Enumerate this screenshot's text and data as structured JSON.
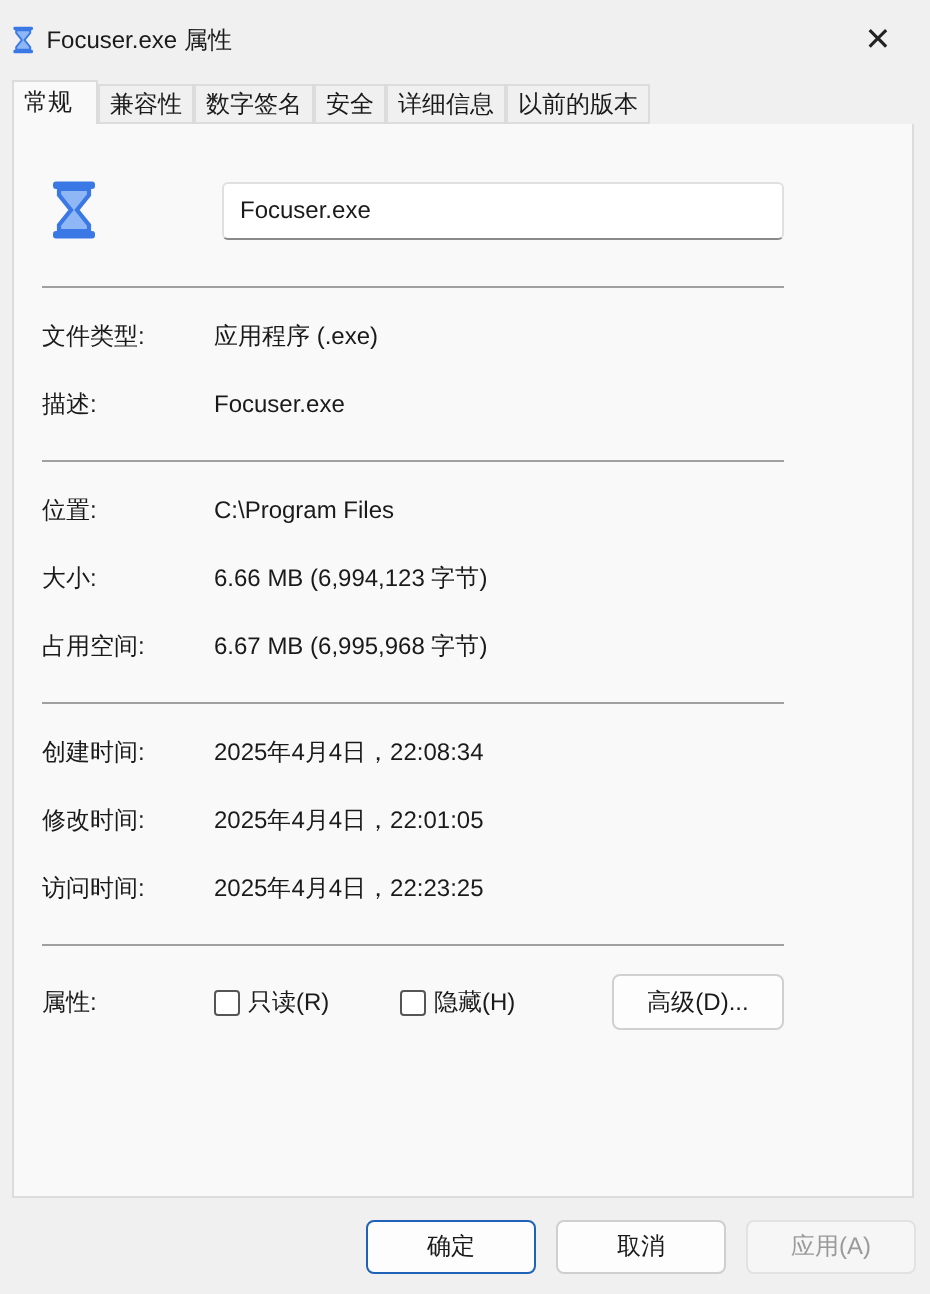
{
  "window": {
    "title": "Focuser.exe 属性",
    "close": "✕"
  },
  "tabs": [
    {
      "label": "常规",
      "selected": true
    },
    {
      "label": "兼容性",
      "selected": false
    },
    {
      "label": "数字签名",
      "selected": false
    },
    {
      "label": "安全",
      "selected": false
    },
    {
      "label": "详细信息",
      "selected": false
    },
    {
      "label": "以前的版本",
      "selected": false
    }
  ],
  "file_name": {
    "value": "Focuser.exe"
  },
  "sections": [
    [
      {
        "label": "文件类型:",
        "value": "应用程序 (.exe)"
      },
      {
        "label": "描述:",
        "value": "Focuser.exe"
      }
    ],
    [
      {
        "label": "位置:",
        "value": "C:\\Program Files"
      },
      {
        "label": "大小:",
        "value": "6.66 MB (6,994,123 字节)"
      },
      {
        "label": "占用空间:",
        "value": "6.67 MB (6,995,968 字节)"
      }
    ],
    [
      {
        "label": "创建时间:",
        "value": "2025年4月4日，22:08:34"
      },
      {
        "label": "修改时间:",
        "value": "2025年4月4日，22:01:05"
      },
      {
        "label": "访问时间:",
        "value": "2025年4月4日，22:23:25"
      }
    ]
  ],
  "attributes": {
    "label": "属性:",
    "checkboxes": [
      {
        "label": "只读(R)",
        "checked": false
      },
      {
        "label": "隐藏(H)",
        "checked": false
      }
    ],
    "advanced_button": "高级(D)..."
  },
  "buttons": [
    {
      "label": "确定",
      "kind": "default",
      "disabled": false
    },
    {
      "label": "取消",
      "kind": "normal",
      "disabled": false
    },
    {
      "label": "应用(A)",
      "kind": "normal",
      "disabled": true
    }
  ]
}
